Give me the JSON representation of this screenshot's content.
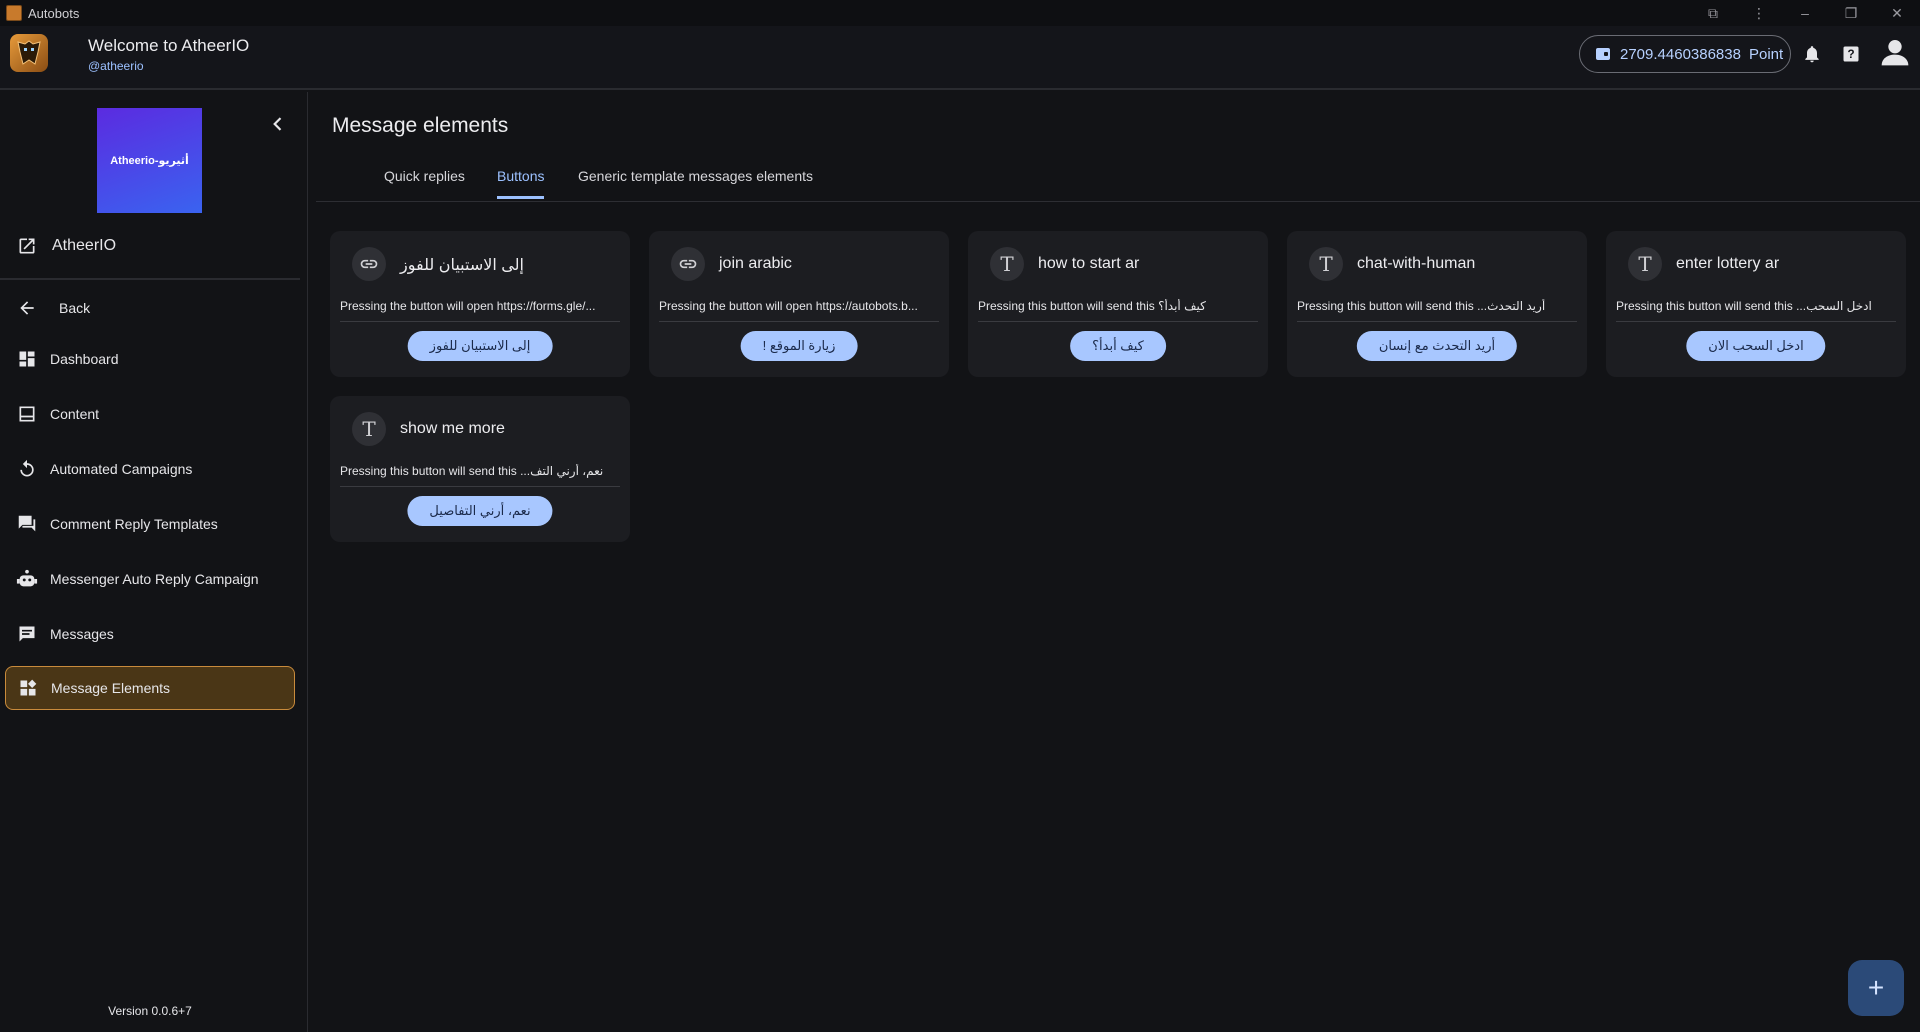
{
  "window": {
    "title": "Autobots"
  },
  "header": {
    "welcome": "Welcome to AtheerIO",
    "handle": "@atheerio",
    "points_value": "2709.4460386838",
    "points_unit": "Point"
  },
  "sidebar": {
    "brand_text": "Atheerio-أثيريو",
    "workspace_label": "AtheerIO",
    "back_label": "Back",
    "items": [
      {
        "label": "Dashboard"
      },
      {
        "label": "Content"
      },
      {
        "label": "Automated Campaigns"
      },
      {
        "label": "Comment Reply Templates"
      },
      {
        "label": "Messenger Auto Reply Campaign"
      },
      {
        "label": "Messages"
      },
      {
        "label": "Message Elements"
      }
    ],
    "version": "Version 0.0.6+7"
  },
  "main": {
    "title": "Message elements",
    "tabs": [
      {
        "label": "Quick replies"
      },
      {
        "label": "Buttons"
      },
      {
        "label": "Generic template messages elements"
      }
    ],
    "cards": [
      {
        "title": "إلى الاستبيان للفوز",
        "desc": "Pressing the button will open https://forms.gle/...",
        "button": "إلى الاستبيان للفوز",
        "icon": "link-icon"
      },
      {
        "title": "join arabic",
        "desc": "Pressing the button will open https://autobots.b...",
        "button": "! زيارة الموقع",
        "icon": "link-icon"
      },
      {
        "title": "how to start ar",
        "desc": "Pressing this button will send this  كيف أبدأ؟",
        "button": "كيف أبدأ؟",
        "icon": "text-icon"
      },
      {
        "title": "chat-with-human",
        "desc": "Pressing this button will send this  ...أريد التحدث",
        "button": "أريد التحدث مع إنسان",
        "icon": "text-icon"
      },
      {
        "title": "enter lottery ar",
        "desc": "Pressing this button will send this  ...ادخل السحب",
        "button": "ادخل السحب الان",
        "icon": "text-icon"
      },
      {
        "title": "show me more",
        "desc": "Pressing this button will send this  ...نعم، أرني التف",
        "button": "نعم، أرني التفاصيل",
        "icon": "text-icon"
      }
    ],
    "fab_label": "+"
  }
}
